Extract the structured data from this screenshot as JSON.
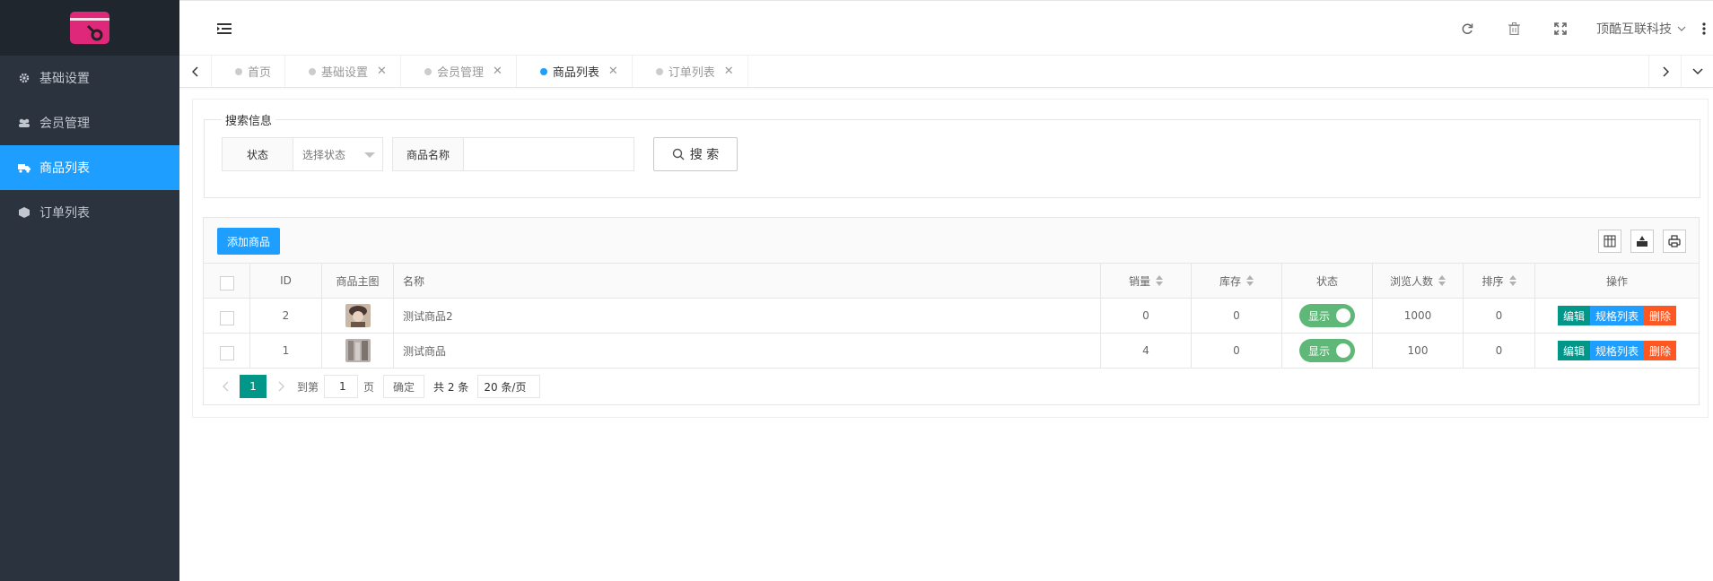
{
  "colors": {
    "sidebar_bg": "#2b333e",
    "accent": "#1e9fff",
    "green": "#009688",
    "danger": "#ff5722",
    "switch_on": "#5fb878",
    "logo": "#e0287a"
  },
  "sidebar": {
    "logo_icon": "wallet-key-logo",
    "items": [
      {
        "label": "基础设置",
        "icon": "gear-icon",
        "active": false
      },
      {
        "label": "会员管理",
        "icon": "users-icon",
        "active": false
      },
      {
        "label": "商品列表",
        "icon": "truck-icon",
        "active": true
      },
      {
        "label": "订单列表",
        "icon": "cube-icon",
        "active": false
      }
    ]
  },
  "header": {
    "menu_toggle_icon": "indent-icon",
    "icons": [
      "refresh-icon",
      "trash-icon",
      "fullscreen-icon"
    ],
    "company": "顶酷互联科技",
    "more_icon": "more-vertical-icon"
  },
  "tabs": [
    {
      "label": "首页",
      "closable": false,
      "active": false
    },
    {
      "label": "基础设置",
      "closable": true,
      "active": false
    },
    {
      "label": "会员管理",
      "closable": true,
      "active": false
    },
    {
      "label": "商品列表",
      "closable": true,
      "active": true
    },
    {
      "label": "订单列表",
      "closable": true,
      "active": false
    }
  ],
  "search": {
    "legend": "搜索信息",
    "status_label": "状态",
    "status_placeholder": "选择状态",
    "name_label": "商品名称",
    "name_value": "",
    "button_label": "搜 索"
  },
  "toolbar": {
    "add_label": "添加商品",
    "icons": [
      "columns-icon",
      "export-icon",
      "print-icon"
    ]
  },
  "table": {
    "columns": {
      "id": "ID",
      "image": "商品主图",
      "name": "名称",
      "sales": "销量",
      "stock": "库存",
      "status": "状态",
      "views": "浏览人数",
      "sort": "排序",
      "ops": "操作"
    },
    "rows": [
      {
        "id": "2",
        "name": "测试商品2",
        "sales": "0",
        "stock": "0",
        "status": "显示",
        "views": "1000",
        "sort": "0"
      },
      {
        "id": "1",
        "name": "测试商品",
        "sales": "4",
        "stock": "0",
        "status": "显示",
        "views": "100",
        "sort": "0"
      }
    ],
    "ops": {
      "edit": "编辑",
      "spec": "规格列表",
      "del": "删除"
    }
  },
  "pager": {
    "current": "1",
    "goto_label": "到第",
    "goto_value": "1",
    "page_unit": "页",
    "confirm": "确定",
    "total": "共 2 条",
    "page_size": "20 条/页"
  }
}
